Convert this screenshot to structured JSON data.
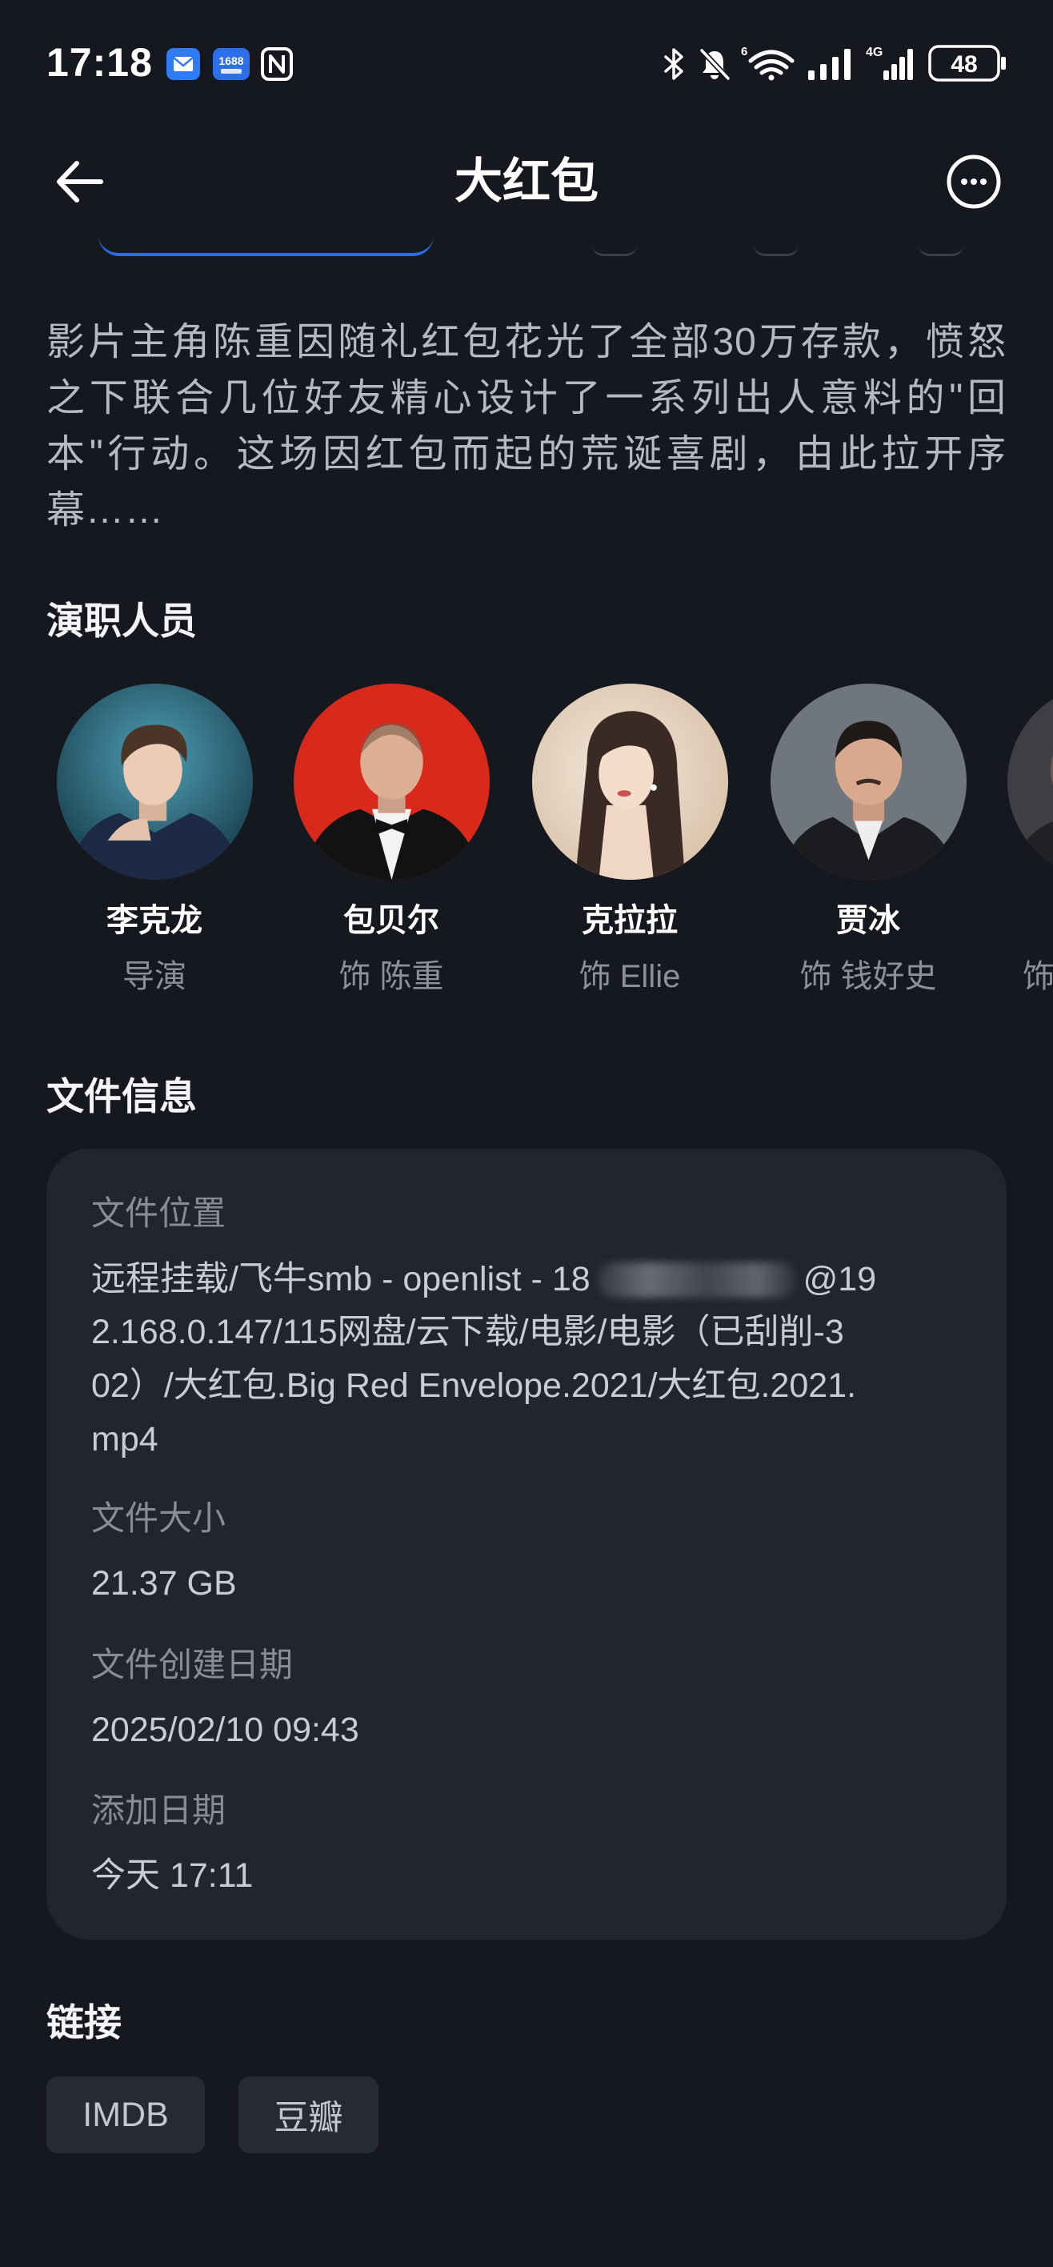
{
  "status_bar": {
    "time": "17:18",
    "app_icon_text": "1688",
    "wifi_label": "6",
    "network_label": "4G",
    "battery_level": "48",
    "icons": [
      "mail-app-icon",
      "1688-app-icon",
      "nfc-icon",
      "bluetooth-icon",
      "bell-muted-icon",
      "wifi-icon",
      "signal-icon",
      "signal-4g-icon",
      "battery-icon"
    ]
  },
  "header": {
    "title": "大红包",
    "back_icon": "arrow-left-icon",
    "more_icon": "more-circle-icon"
  },
  "description_lines": [
    "影片主角陈重因随礼红包花光了全部30万存款，愤怒",
    "之下联合几位好友精心设计了一系列出人意料的\"回",
    "本\"行动。这场因红包而起的荒诞喜剧，由此拉开序",
    "幕……"
  ],
  "cast": {
    "heading": "演职人员",
    "items": [
      {
        "name": "李克龙",
        "role": "导演"
      },
      {
        "name": "包贝尔",
        "role": "饰 陈重"
      },
      {
        "name": "克拉拉",
        "role": "饰 Ellie"
      },
      {
        "name": "贾冰",
        "role": "饰 钱好史"
      },
      {
        "name": "",
        "role": "饰"
      }
    ]
  },
  "file_info": {
    "heading": "文件信息",
    "location_label": "文件位置",
    "location": {
      "line1_prefix": "远程挂载/飞牛smb - openlist - 18",
      "line1_suffix": "@19",
      "rest": [
        "2.168.0.147/115网盘/云下载/电影/电影（已刮削-3",
        "02）/大红包.Big Red Envelope.2021/大红包.2021.",
        "mp4"
      ]
    },
    "size_label": "文件大小",
    "size_value": "21.37 GB",
    "created_label": "文件创建日期",
    "created_value": "2025/02/10 09:43",
    "added_label": "添加日期",
    "added_value": "今天 17:11"
  },
  "links": {
    "heading": "链接",
    "buttons": [
      {
        "label": "IMDB"
      },
      {
        "label": "豆瓣"
      }
    ]
  },
  "colors": {
    "background": "#15181e",
    "card": "#22252c",
    "accent": "#2a6ae8",
    "button": "#262a31"
  }
}
